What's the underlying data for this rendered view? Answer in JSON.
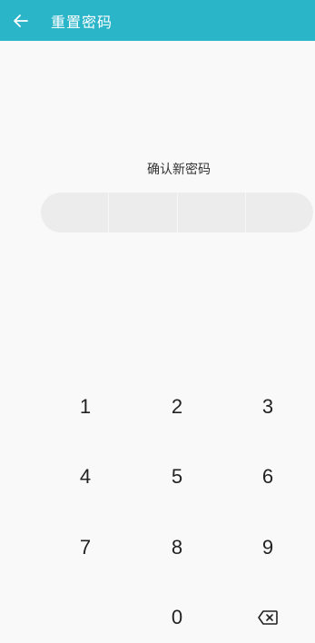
{
  "header": {
    "title": "重置密码",
    "background": "#2bb5c9",
    "back_icon": "arrow-left-icon"
  },
  "prompt": {
    "text": "确认新密码"
  },
  "pin": {
    "length": 4,
    "filled": 0
  },
  "keypad": {
    "keys": [
      "1",
      "2",
      "3",
      "4",
      "5",
      "6",
      "7",
      "8",
      "9",
      "0"
    ],
    "delete_icon": "backspace-icon"
  }
}
